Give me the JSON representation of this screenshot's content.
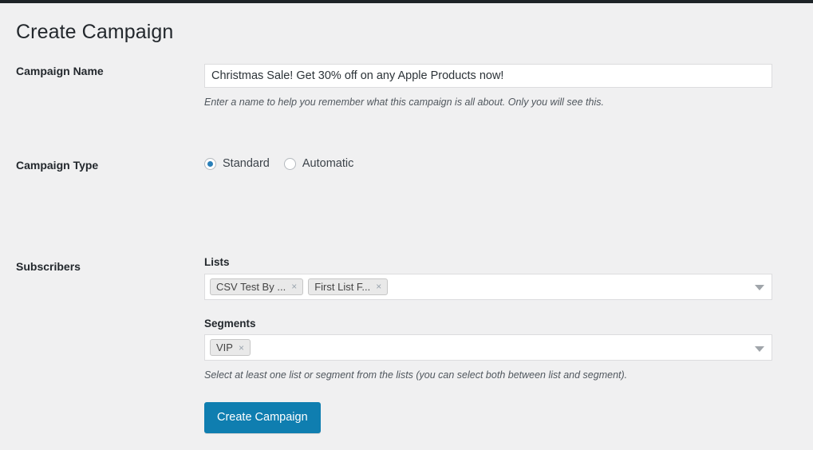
{
  "page": {
    "title": "Create Campaign"
  },
  "fields": {
    "campaign_name": {
      "label": "Campaign Name",
      "value": "Christmas Sale! Get 30% off on any Apple Products now!",
      "placeholder": "",
      "help": "Enter a name to help you remember what this campaign is all about. Only you will see this."
    },
    "campaign_type": {
      "label": "Campaign Type",
      "options": [
        {
          "label": "Standard",
          "selected": true
        },
        {
          "label": "Automatic",
          "selected": false
        }
      ]
    },
    "subscribers": {
      "label": "Subscribers",
      "lists": {
        "label": "Lists",
        "tags": [
          "CSV Test By ...",
          "First List F..."
        ],
        "remove_icon": "×"
      },
      "segments": {
        "label": "Segments",
        "tags": [
          "VIP"
        ],
        "remove_icon": "×"
      },
      "help": "Select at least one list or segment from the lists (you can select both between list and segment)."
    }
  },
  "submit": {
    "label": "Create Campaign"
  },
  "colors": {
    "accent": "#0f7eb0",
    "radio_selected": "#2a7fb8",
    "background": "#f0f0f1",
    "admin_bar": "#1d2327"
  }
}
